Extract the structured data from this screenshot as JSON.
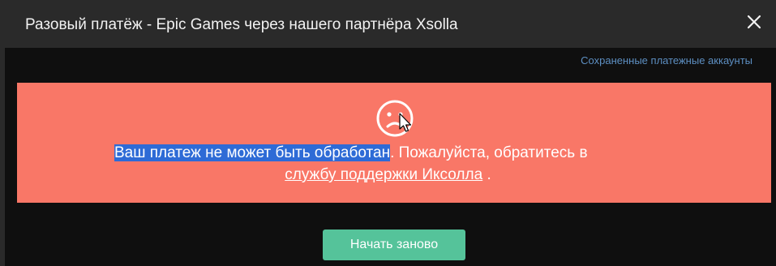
{
  "dialog": {
    "title": "Разовый платёж - Epic Games через нашего партнёра Xsolla",
    "close_icon": "close-icon"
  },
  "links": {
    "saved_accounts": "Сохраненные платежные аккаунты"
  },
  "error": {
    "icon": "sad-face-icon",
    "message_highlighted": "Ваш платеж не может быть обработан",
    "message_rest": ". Пожалуйста, обратитесь в",
    "support_link": "службу поддержки Иксолла",
    "message_end": " .",
    "panel_color": "#f97767",
    "highlight_color": "#2e6bd6"
  },
  "actions": {
    "restart_label": "Начать заново",
    "restart_color": "#55c39a"
  }
}
